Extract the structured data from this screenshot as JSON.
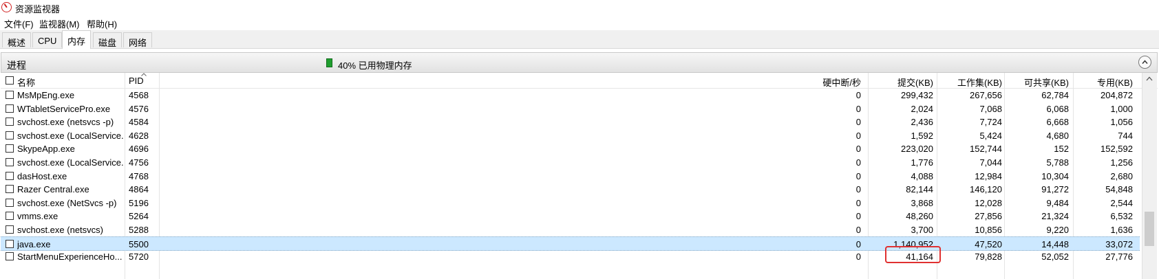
{
  "window": {
    "title": "资源监视器"
  },
  "menu": [
    "文件(F)",
    "监视器(M)",
    "帮助(H)"
  ],
  "tabs": [
    "概述",
    "CPU",
    "内存",
    "磁盘",
    "网络"
  ],
  "active_tab": "内存",
  "section": {
    "title": "进程",
    "memory_status": "40% 已用物理内存"
  },
  "columns": {
    "name": "名称",
    "pid": "PID",
    "hard_faults": "硬中断/秒",
    "commit": "提交(KB)",
    "working_set": "工作集(KB)",
    "shareable": "可共享(KB)",
    "private": "专用(KB)"
  },
  "rows": [
    {
      "name": "MsMpEng.exe",
      "pid": "4568",
      "hard": "0",
      "commit": "299,432",
      "ws": "267,656",
      "share": "62,784",
      "priv": "204,872"
    },
    {
      "name": "WTabletServicePro.exe",
      "pid": "4576",
      "hard": "0",
      "commit": "2,024",
      "ws": "7,068",
      "share": "6,068",
      "priv": "1,000"
    },
    {
      "name": "svchost.exe (netsvcs -p)",
      "pid": "4584",
      "hard": "0",
      "commit": "2,436",
      "ws": "7,724",
      "share": "6,668",
      "priv": "1,056"
    },
    {
      "name": "svchost.exe (LocalService...",
      "pid": "4628",
      "hard": "0",
      "commit": "1,592",
      "ws": "5,424",
      "share": "4,680",
      "priv": "744"
    },
    {
      "name": "SkypeApp.exe",
      "pid": "4696",
      "hard": "0",
      "commit": "223,020",
      "ws": "152,744",
      "share": "152",
      "priv": "152,592"
    },
    {
      "name": "svchost.exe (LocalService...",
      "pid": "4756",
      "hard": "0",
      "commit": "1,776",
      "ws": "7,044",
      "share": "5,788",
      "priv": "1,256"
    },
    {
      "name": "dasHost.exe",
      "pid": "4768",
      "hard": "0",
      "commit": "4,088",
      "ws": "12,984",
      "share": "10,304",
      "priv": "2,680"
    },
    {
      "name": "Razer Central.exe",
      "pid": "4864",
      "hard": "0",
      "commit": "82,144",
      "ws": "146,120",
      "share": "91,272",
      "priv": "54,848"
    },
    {
      "name": "svchost.exe (NetSvcs -p)",
      "pid": "5196",
      "hard": "0",
      "commit": "3,868",
      "ws": "12,028",
      "share": "9,484",
      "priv": "2,544"
    },
    {
      "name": "vmms.exe",
      "pid": "5264",
      "hard": "0",
      "commit": "48,260",
      "ws": "27,856",
      "share": "21,324",
      "priv": "6,532"
    },
    {
      "name": "svchost.exe (netsvcs)",
      "pid": "5288",
      "hard": "0",
      "commit": "3,700",
      "ws": "10,856",
      "share": "9,220",
      "priv": "1,636"
    },
    {
      "name": "java.exe",
      "pid": "5500",
      "hard": "0",
      "commit": "1,140,952",
      "ws": "47,520",
      "share": "14,448",
      "priv": "33,072"
    },
    {
      "name": "StartMenuExperienceHo...",
      "pid": "5720",
      "hard": "0",
      "commit": "41,164",
      "ws": "79,828",
      "share": "52,052",
      "priv": "27,776"
    }
  ],
  "selected_row_index": 11,
  "colors": {
    "selected_row": "#cce8ff",
    "highlight_box": "#e03030",
    "memory_indicator": "#1f9e2e"
  },
  "icons": [
    "resource-monitor-app-icon",
    "collapse-chevron-icon",
    "sort-ascending-icon",
    "scroll-up-icon"
  ]
}
